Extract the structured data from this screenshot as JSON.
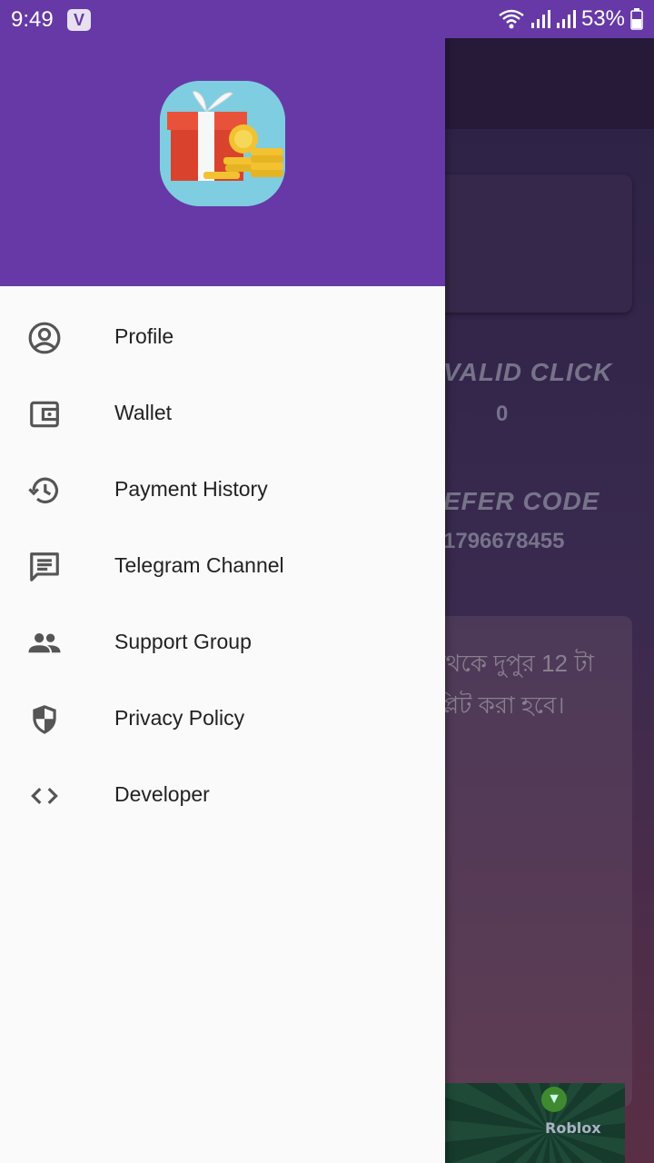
{
  "status_bar": {
    "time": "9:49",
    "notification_badge": "V",
    "battery": "53%",
    "icons": [
      "wifi-icon",
      "signal-icon",
      "signal-icon",
      "battery-icon"
    ]
  },
  "background_app": {
    "valid_click_label": "VALID CLICK",
    "valid_click_value": "0",
    "refer_code_label": "EFER CODE",
    "refer_code_value": "1796678455",
    "notice_line1": "থেকে দুপুর 12 টা",
    "notice_line2": "প্লিট করা হবে।",
    "ad_text": "Roblox"
  },
  "drawer": {
    "logo_icon": "gift-box-coins-icon",
    "items": [
      {
        "label": "Profile",
        "icon": "account-circle-icon"
      },
      {
        "label": "Wallet",
        "icon": "wallet-icon"
      },
      {
        "label": "Payment History",
        "icon": "history-icon"
      },
      {
        "label": "Telegram Channel",
        "icon": "chat-message-icon"
      },
      {
        "label": "Support Group",
        "icon": "group-icon"
      },
      {
        "label": "Privacy Policy",
        "icon": "shield-icon"
      },
      {
        "label": "Developer",
        "icon": "code-icon"
      }
    ]
  },
  "colors": {
    "primary": "#6639a6",
    "drawer_bg": "#fafafa",
    "icon_gray": "#555555",
    "text": "#222222"
  }
}
